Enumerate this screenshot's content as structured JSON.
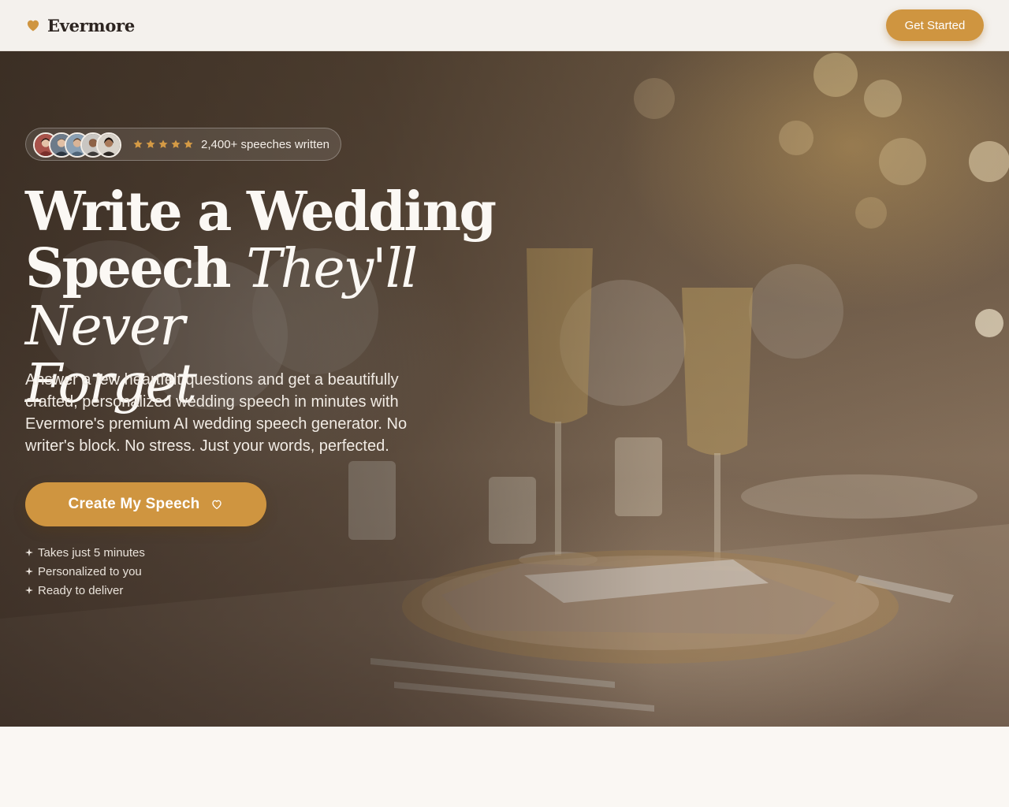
{
  "nav": {
    "brand_name": "Evermore",
    "brand_icon": "heart-icon",
    "cta_label": "Get Started"
  },
  "hero": {
    "social_proof": {
      "avatar_count": 5,
      "rating_stars": 5,
      "text": "2,400+ speeches written"
    },
    "headline": {
      "line1": "Write a Wedding",
      "line2_plain": "Speech",
      "line2_accent": "They'll Never",
      "line3_accent": "Forget"
    },
    "subtext": "Answer a few heartfelt questions and get a beautifully crafted, personalized wedding speech in minutes with Evermore's premium AI wedding speech generator. No writer's block. No stress. Just your words, perfected.",
    "cta_label": "Create My Speech",
    "cta_icon": "heart-outline-icon",
    "features": [
      "Takes just 5 minutes",
      "Personalized to you",
      "Ready to deliver"
    ]
  },
  "colors": {
    "accent": "#cf9540",
    "nav_background": "#f4f1ed",
    "brand_text": "#2c2420",
    "page_background": "#faf7f3"
  }
}
